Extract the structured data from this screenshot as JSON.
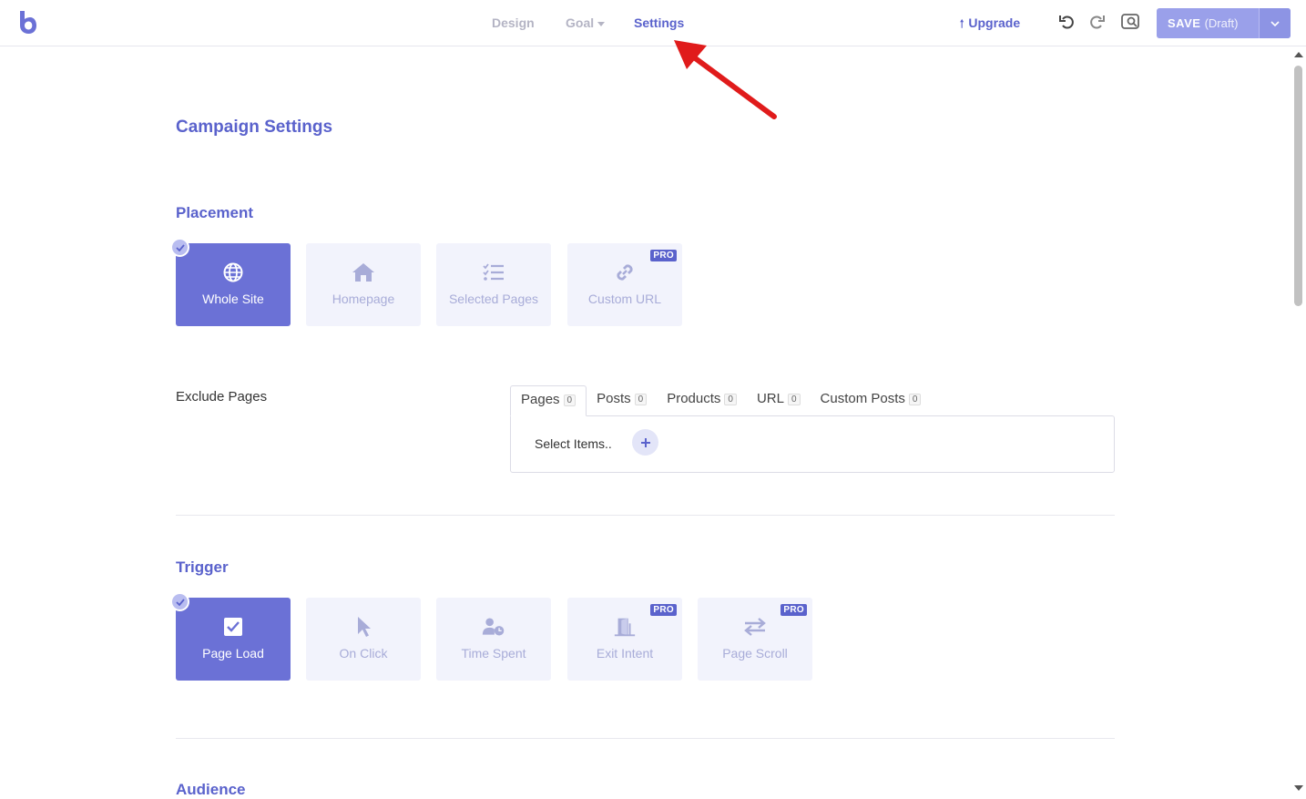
{
  "topbar": {
    "nav": {
      "design": "Design",
      "goal": "Goal",
      "settings": "Settings"
    },
    "upgrade_label": "Upgrade",
    "save_label": "SAVE",
    "save_status": "(Draft)",
    "icons": [
      "logo-icon",
      "undo-icon",
      "redo-icon",
      "preview-icon",
      "chevron-down-icon"
    ],
    "accent_color": "#5a62cc"
  },
  "main": {
    "page_title": "Campaign Settings",
    "placement": {
      "title": "Placement",
      "options": [
        {
          "label": "Whole Site",
          "icon": "globe-icon",
          "selected": true,
          "pro": false
        },
        {
          "label": "Homepage",
          "icon": "home-icon",
          "selected": false,
          "pro": false
        },
        {
          "label": "Selected Pages",
          "icon": "checklist-icon",
          "selected": false,
          "pro": false
        },
        {
          "label": "Custom URL",
          "icon": "link-icon",
          "selected": false,
          "pro": true
        }
      ]
    },
    "exclude": {
      "label": "Exclude Pages",
      "tabs": [
        {
          "label": "Pages",
          "count": "0",
          "active": true
        },
        {
          "label": "Posts",
          "count": "0",
          "active": false
        },
        {
          "label": "Products",
          "count": "0",
          "active": false
        },
        {
          "label": "URL",
          "count": "0",
          "active": false
        },
        {
          "label": "Custom Posts",
          "count": "0",
          "active": false
        }
      ],
      "placeholder": "Select Items.."
    },
    "trigger": {
      "title": "Trigger",
      "options": [
        {
          "label": "Page Load",
          "icon": "checkbox-icon",
          "selected": true,
          "pro": false
        },
        {
          "label": "On Click",
          "icon": "cursor-icon",
          "selected": false,
          "pro": false
        },
        {
          "label": "Time Spent",
          "icon": "user-clock-icon",
          "selected": false,
          "pro": false
        },
        {
          "label": "Exit Intent",
          "icon": "door-exit-icon",
          "selected": false,
          "pro": true
        },
        {
          "label": "Page Scroll",
          "icon": "arrows-exchange-icon",
          "selected": false,
          "pro": true
        }
      ]
    },
    "audience": {
      "title": "Audience"
    },
    "pro_badge": "PRO"
  }
}
